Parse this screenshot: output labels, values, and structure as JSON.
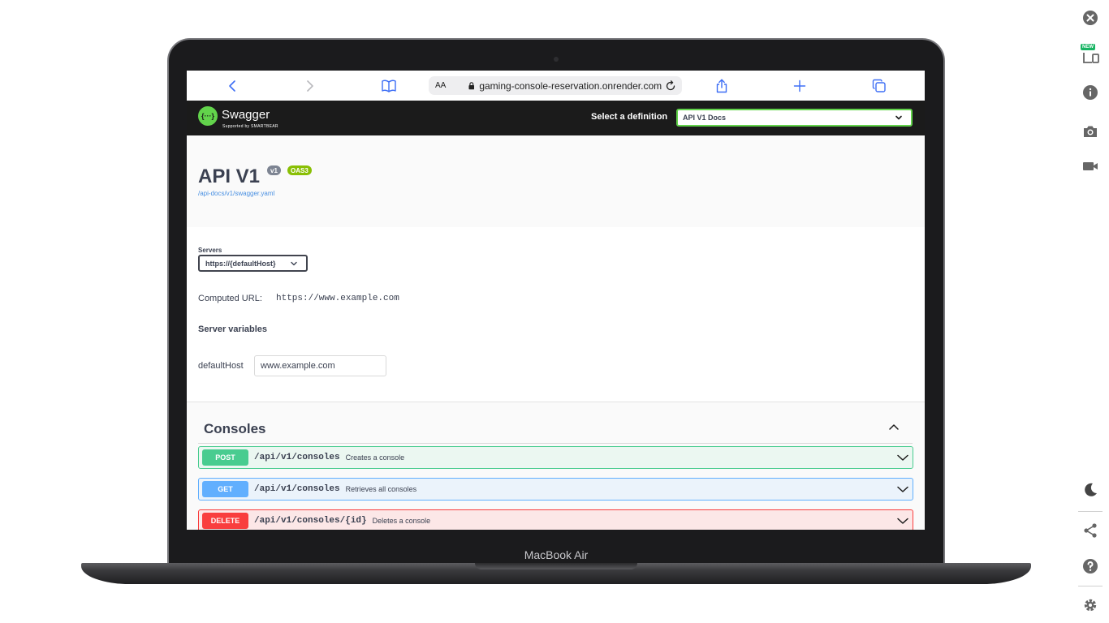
{
  "browser": {
    "reader_label": "AA",
    "url": "gaming-console-reservation.onrender.com"
  },
  "swagger": {
    "logo_name": "Swagger",
    "logo_sub": "Supported by SMARTBEAR",
    "logo_glyph": "{···}",
    "definition_label": "Select a definition",
    "definition_value": "API V1 Docs"
  },
  "info": {
    "title": "API V1",
    "version_badge": "v1",
    "oas_badge": "OAS3",
    "spec_link": "/api-docs/v1/swagger.yaml"
  },
  "servers": {
    "label": "Servers",
    "selected": "https://{defaultHost}",
    "computed_label": "Computed URL:",
    "computed_url": "https://www.example.com",
    "variables_label": "Server variables",
    "variable_name": "defaultHost",
    "variable_value": "www.example.com"
  },
  "section": {
    "tag": "Consoles",
    "operations": [
      {
        "method": "POST",
        "path": "/api/v1/consoles",
        "summary": "Creates a console",
        "color": "#49cc90"
      },
      {
        "method": "GET",
        "path": "/api/v1/consoles",
        "summary": "Retrieves all consoles",
        "color": "#61affe"
      },
      {
        "method": "DELETE",
        "path": "/api/v1/consoles/{id}",
        "summary": "Deletes a console",
        "color": "#f93e3e"
      }
    ]
  },
  "device": {
    "name": "MacBook Air"
  },
  "rail": {
    "new_badge": "NEW",
    "icons": [
      "close-icon",
      "responsive-icon",
      "info-icon",
      "camera-icon",
      "video-icon",
      "moon-icon",
      "share-icon",
      "help-icon",
      "settings-icon"
    ]
  },
  "colors": {
    "accent": "#62d34b",
    "topbar": "#1b1b1b",
    "text": "#3b4151"
  }
}
